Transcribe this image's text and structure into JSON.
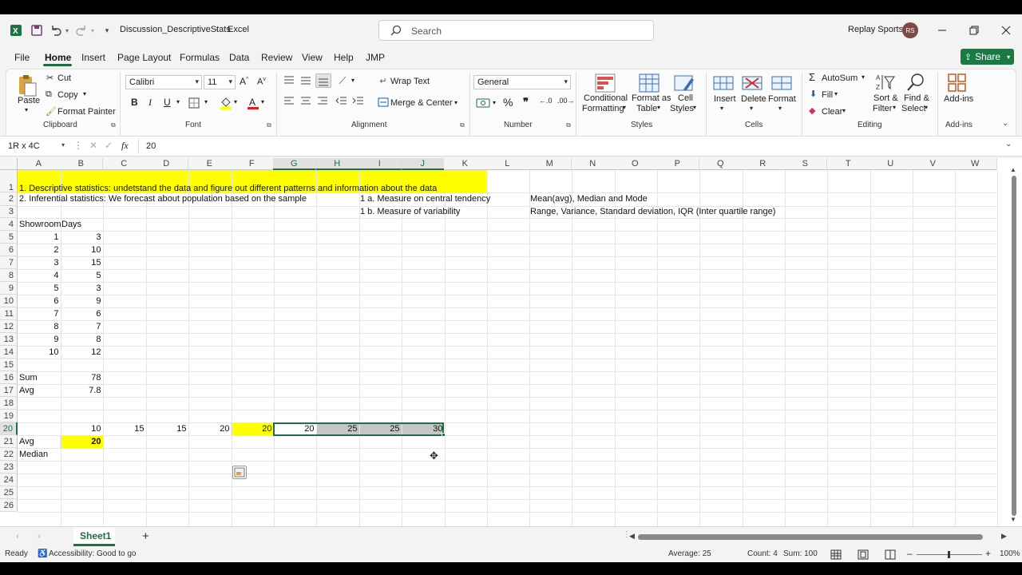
{
  "titlebar": {
    "doc_title": "Discussion_DescriptiveStats",
    "app_name": "Excel",
    "search_placeholder": "Search",
    "user_name": "Replay Sports",
    "user_initials": "RS"
  },
  "menu": [
    "File",
    "Home",
    "Insert",
    "Page Layout",
    "Formulas",
    "Data",
    "Review",
    "View",
    "Help",
    "JMP"
  ],
  "share_label": "Share",
  "ribbon": {
    "paste": "Paste",
    "cut": "Cut",
    "copy": "Copy",
    "format_painter": "Format Painter",
    "font_name": "Calibri",
    "font_size": "11",
    "wrap_text": "Wrap Text",
    "merge_center": "Merge & Center",
    "number_format": "General",
    "conditional_formatting": [
      "Conditional",
      "Formatting"
    ],
    "format_as_table": [
      "Format as",
      "Table"
    ],
    "cell_styles": [
      "Cell",
      "Styles"
    ],
    "insert": "Insert",
    "delete": "Delete",
    "format": "Format",
    "autosum": "AutoSum",
    "fill": "Fill",
    "clear": "Clear",
    "sort_filter": [
      "Sort &",
      "Filter"
    ],
    "find_select": [
      "Find &",
      "Select"
    ],
    "addins": "Add-ins",
    "groups": [
      "Clipboard",
      "Font",
      "Alignment",
      "Number",
      "Styles",
      "Cells",
      "Editing",
      "Add-ins"
    ]
  },
  "formula_bar": {
    "name_box": "1R x 4C",
    "fx": "fx",
    "value": "20"
  },
  "columns": [
    "A",
    "B",
    "C",
    "D",
    "E",
    "F",
    "G",
    "H",
    "I",
    "J",
    "K",
    "L",
    "M",
    "N",
    "O",
    "P",
    "Q",
    "R",
    "S",
    "T",
    "U",
    "V",
    "W"
  ],
  "rows": [
    "1",
    "2",
    "3",
    "4",
    "5",
    "6",
    "7",
    "8",
    "9",
    "10",
    "11",
    "12",
    "13",
    "14",
    "15",
    "16",
    "17",
    "18",
    "19",
    "20",
    "21",
    "22",
    "23",
    "24",
    "25",
    "26"
  ],
  "cells": {
    "A1": "1. Descriptive statistics: undetstand the data and figure out different patterns and information about the data",
    "A2": "2. Inferential statistics: We forecast about population based on the sample",
    "I2": "1 a. Measure on central tendency",
    "M2": "Mean(avg), Median and Mode",
    "I3": "1 b. Measure of variability",
    "M3": "Range, Variance, Standard deviation, IQR (Inter quartile range)",
    "A4": "Showroom",
    "B4": "Days",
    "A5": "1",
    "B5": "3",
    "A6": "2",
    "B6": "10",
    "A7": "3",
    "B7": "15",
    "A8": "4",
    "B8": "5",
    "A9": "5",
    "B9": "3",
    "A10": "6",
    "B10": "9",
    "A11": "7",
    "B11": "6",
    "A12": "8",
    "B12": "7",
    "A13": "9",
    "B13": "8",
    "A14": "10",
    "B14": "12",
    "A16": "Sum",
    "B16": "78",
    "A17": "Avg",
    "B17": "7.8",
    "B20": "10",
    "C20": "15",
    "D20": "15",
    "E20": "20",
    "F20": "20",
    "G20": "20",
    "H20": "25",
    "I20": "25",
    "J20": "30",
    "A21": "Avg",
    "B21": "20",
    "A22": "Median"
  },
  "sheet_tab": "Sheet1",
  "status": {
    "ready": "Ready",
    "accessibility": "Accessibility: Good to go",
    "average": "Average: 25",
    "count": "Count: 4",
    "sum": "Sum: 100",
    "zoom": "100%"
  },
  "colors": {
    "highlight": "#ffff00",
    "accent": "#1d7044",
    "selection": "#c6c6c6"
  }
}
